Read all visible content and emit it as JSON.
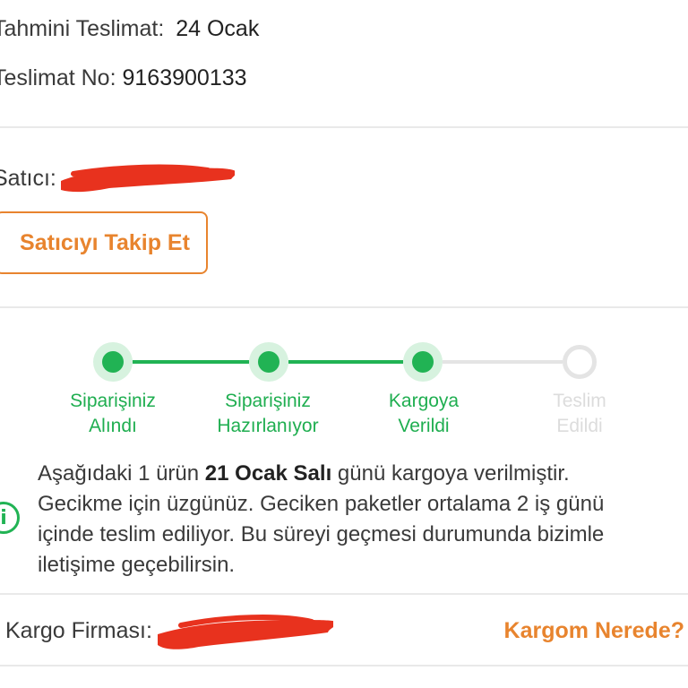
{
  "delivery": {
    "estimated_label": "Tahmini Teslimat:",
    "estimated_value": "24 Ocak",
    "number_label": "Teslimat No:",
    "number_value": "9163900133"
  },
  "seller": {
    "label": "Satıcı:",
    "follow_button": "Satıcıyı Takip Et"
  },
  "stepper": {
    "steps": [
      {
        "line1": "Siparişiniz",
        "line2": "Alındı",
        "status": "done"
      },
      {
        "line1": "Siparişiniz",
        "line2": "Hazırlanıyor",
        "status": "done"
      },
      {
        "line1": "Kargoya",
        "line2": "Verildi",
        "status": "done"
      },
      {
        "line1": "Teslim",
        "line2": "Edildi",
        "status": "todo"
      }
    ],
    "colors": {
      "done": "#21b354",
      "todo": "#e4e4e4"
    }
  },
  "info": {
    "line1_a": "Aşağıdaki 1 ürün ",
    "line1_bold": "21 Ocak Salı",
    "line1_b": " günü kargoya verilmiştir.",
    "line2": "Gecikme için üzgünüz. Geciken paketler ortalama 2 iş günü",
    "line3": "içinde teslim ediliyor. Bu süreyi geçmesi durumunda bizimle",
    "line4": "iletişime geçebilirsin.",
    "icon": "info-icon"
  },
  "cargo": {
    "label": "Kargo Firması:",
    "link": "Kargom Nerede?"
  },
  "colors": {
    "accent": "#e8842e",
    "success": "#21b354",
    "redaction": "#e8321e"
  }
}
